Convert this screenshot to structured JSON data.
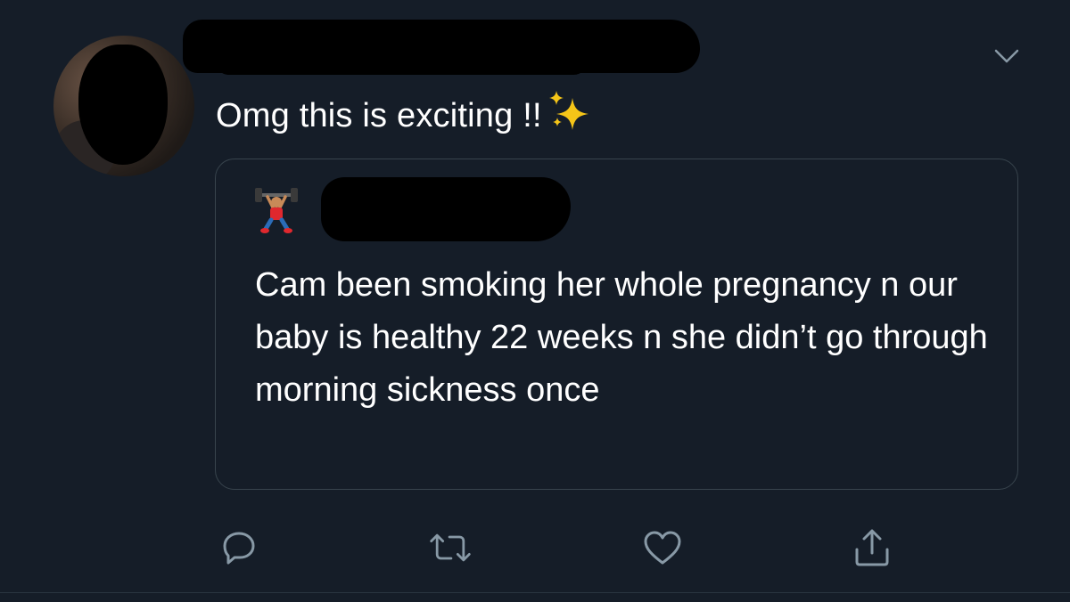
{
  "tweet": {
    "author_name": "",
    "text": "Omg this is exciting !!",
    "emoji": "sparkles"
  },
  "quoted_tweet": {
    "author_emoji": "person-lifting-weights",
    "text": "Cam been smoking her whole pregnancy n our baby is healthy 22 weeks n she didn’t go through morning sickness once"
  },
  "actions": {
    "reply": "reply-icon",
    "retweet": "retweet-icon",
    "like": "heart-icon",
    "share": "share-icon"
  },
  "colors": {
    "background": "#151d28",
    "text": "#ffffff",
    "icon": "#8899a6",
    "border": "#38444d"
  }
}
